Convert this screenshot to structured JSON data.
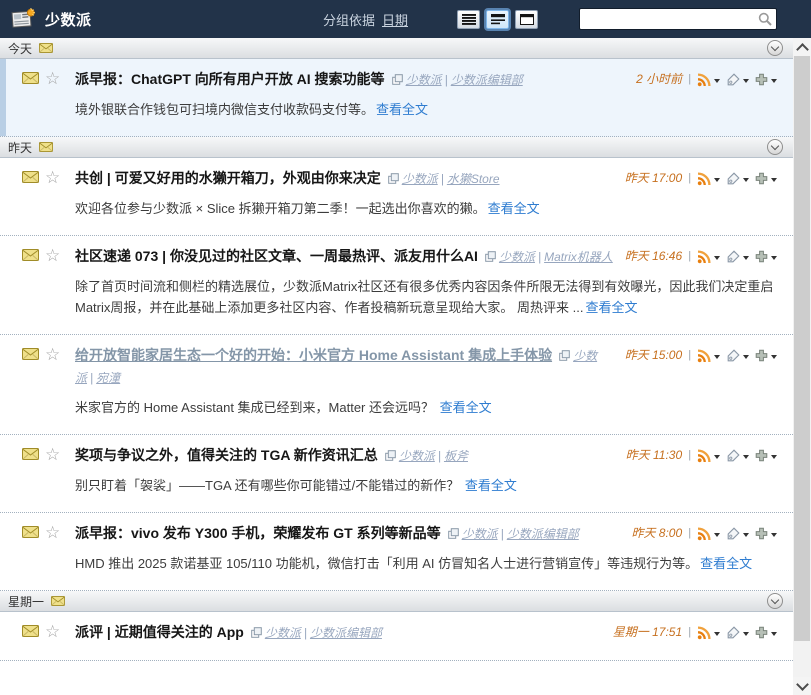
{
  "header": {
    "feed_title": "少数派",
    "group_by_label": "分组依据",
    "group_by_value": "日期",
    "search_value": ""
  },
  "ui": {
    "read_more": "查看全文",
    "separator": "|"
  },
  "colors": {
    "header_bg": "#223349",
    "time_text": "#c66f1e",
    "read_more_link": "#2e7cd0",
    "meta_text": "#97a6be",
    "selected_row_bg": "#eef5fc",
    "selected_row_stripe": "#b9cfe5",
    "rss_icon": "#e87f0e"
  },
  "icons": {
    "app_logo": "newspaper-with-orange-star",
    "unread": "yellow-envelope",
    "favorite": "star-outline",
    "clipping": "overlapping-squares",
    "feed_menu": "rss",
    "tag_menu": "tag",
    "share_menu": "plus",
    "search": "magnifier",
    "group_collapse": "chevron-down-in-circle",
    "view_modes": [
      "list-lines",
      "headlines",
      "full-posts"
    ],
    "scrollbar": [
      "chevron-up",
      "chevron-down"
    ]
  },
  "groups": [
    {
      "label": "今天",
      "articles": [
        {
          "title": "派早报：ChatGPT 向所有用户开放 AI 搜索功能等",
          "feed": "少数派",
          "author": "少数派编辑部",
          "time": "2 小时前",
          "summary": "境外银联合作钱包可扫境内微信支付收款码支付等。",
          "selected": true
        }
      ]
    },
    {
      "label": "昨天",
      "articles": [
        {
          "title": "共创 | 可爱又好用的水獭开箱刀，外观由你来决定",
          "feed": "少数派",
          "author": "水獭Store",
          "time": "昨天 17:00",
          "summary": "欢迎各位参与少数派 × Slice 拆獭开箱刀第二季！一起选出你喜欢的獭。"
        },
        {
          "title": "社区速递 073 | 你没见过的社区文章、一周最热评、派友用什么AI",
          "feed": "少数派",
          "author": "Matrix机器人",
          "time": "昨天 16:46",
          "summary": "除了首页时间流和侧栏的精选展位，少数派Matrix社区还有很多优秀内容因条件所限无法得到有效曝光，因此我们决定重启Matrix周报，并在此基础上添加更多社区内容、作者投稿新玩意呈现给大家。 周热评来 ..."
        },
        {
          "title": "给开放智能家居生态一个好的开始：小米官方 Home Assistant 集成上手体验",
          "feed": "少数派",
          "author": "宛潼",
          "time": "昨天 15:00",
          "summary": "米家官方的 Home Assistant 集成已经到来，Matter 还会远吗？",
          "title_visited": true
        },
        {
          "title": "奖项与争议之外，值得关注的 TGA 新作资讯汇总",
          "feed": "少数派",
          "author": "板斧",
          "time": "昨天 11:30",
          "summary": "别只盯着「袈裟」——TGA 还有哪些你可能错过/不能错过的新作？"
        },
        {
          "title": "派早报：vivo 发布 Y300 手机，荣耀发布 GT 系列等新品等",
          "feed": "少数派",
          "author": "少数派编辑部",
          "time": "昨天 8:00",
          "summary": "HMD 推出 2025 款诺基亚 105/110 功能机，微信打击「利用 AI 仿冒知名人士进行营销宣传」等违规行为等。"
        }
      ]
    },
    {
      "label": "星期一",
      "articles": [
        {
          "title": "派评 | 近期值得关注的 App",
          "feed": "少数派",
          "author": "少数派编辑部",
          "time": "星期一 17:51"
        }
      ]
    }
  ]
}
